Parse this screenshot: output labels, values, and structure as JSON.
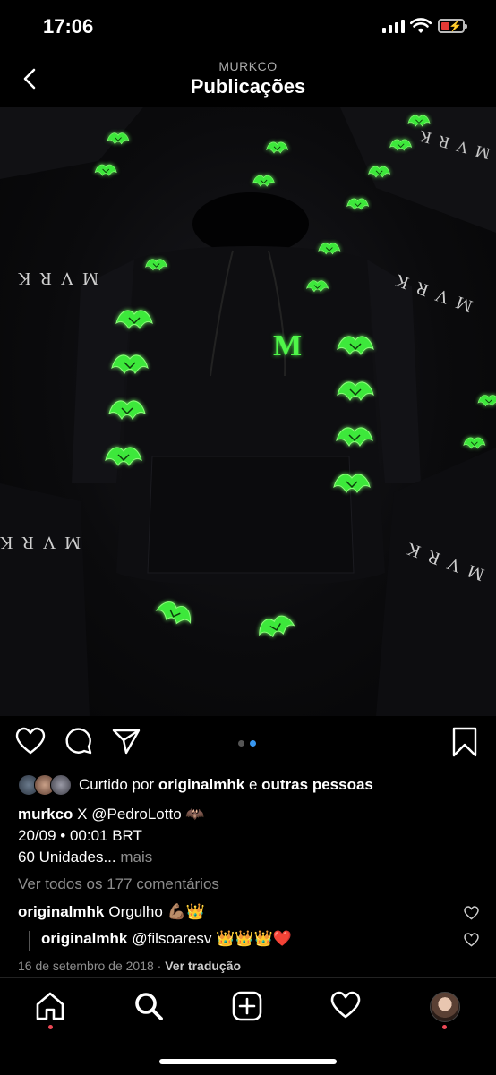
{
  "status_bar": {
    "time": "17:06"
  },
  "header": {
    "account": "MURKCO",
    "title": "Publicações"
  },
  "post": {
    "carousel": {
      "count": 2,
      "active": 2
    },
    "liked_by": {
      "prefix": "Curtido por",
      "user": "originalmhk",
      "joiner": "e",
      "others": "outras pessoas"
    },
    "caption": {
      "user": "murkco",
      "line1": "X @PedroLotto 🦇",
      "line2": "20/09 • 00:01 BRT",
      "line3": "60 Unidades...",
      "more": "mais"
    },
    "view_all": "Ver todos os 177 comentários",
    "comments": [
      {
        "user": "originalmhk",
        "text": "Orgulho 💪🏽👑"
      },
      {
        "user": "originalmhk",
        "text": "@filsoaresv 👑👑👑❤️"
      }
    ],
    "date": "16 de setembro de 2018",
    "separator": "·",
    "translate": "Ver tradução"
  },
  "photo_text": {
    "logo": "M",
    "wordmark": "MVRK"
  },
  "icons": [
    "back-chevron-icon",
    "heart-icon",
    "comment-icon",
    "send-icon",
    "bookmark-icon",
    "home-icon",
    "search-icon",
    "new-post-icon",
    "activity-heart-icon",
    "profile-avatar"
  ],
  "colors": {
    "background": "#000000",
    "muted": "#8e8e8e",
    "accent": "#3897f0",
    "notification": "#ed4956",
    "neon": "#4ff54a"
  }
}
